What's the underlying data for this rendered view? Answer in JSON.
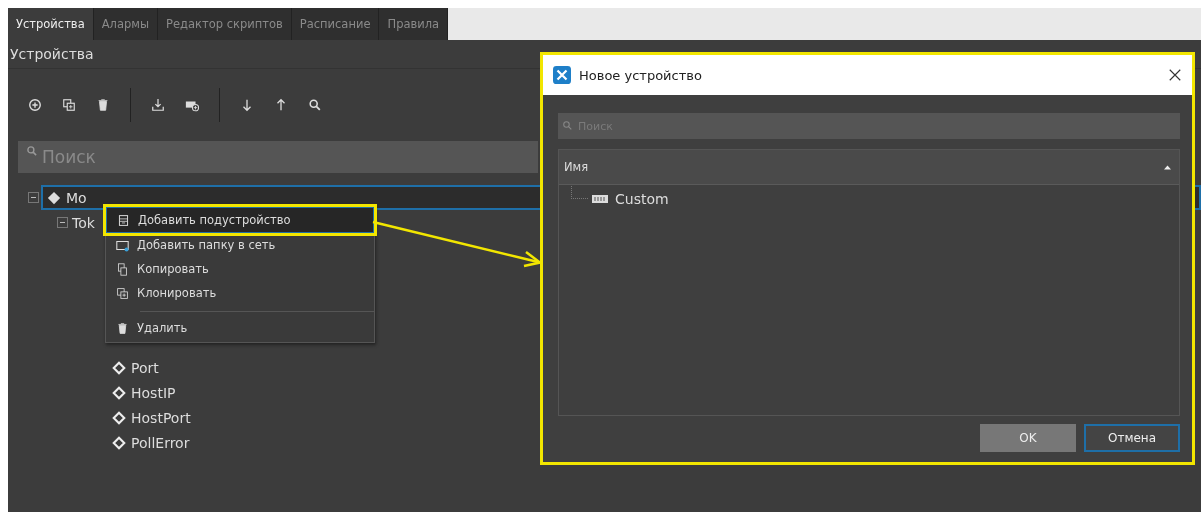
{
  "tabs": [
    {
      "label": "Устройства",
      "selected": true
    },
    {
      "label": "Алармы",
      "selected": false
    },
    {
      "label": "Редактор скриптов",
      "selected": false
    },
    {
      "label": "Расписание",
      "selected": false
    },
    {
      "label": "Правила",
      "selected": false
    }
  ],
  "panel": {
    "title": "Устройства",
    "search": {
      "placeholder": "Поиск"
    }
  },
  "tree": [
    {
      "label": "Mo",
      "kind": "device",
      "expanded": true,
      "selected": true,
      "children": [
        {
          "label": "Tok",
          "expanded": true,
          "selected": false,
          "children": [
            {
              "label": "Port",
              "kind": "tag",
              "selected": false
            },
            {
              "label": "HostIP",
              "kind": "tag",
              "selected": false
            },
            {
              "label": "HostPort",
              "kind": "tag",
              "selected": false
            },
            {
              "label": "PollError",
              "kind": "tag",
              "selected": false
            }
          ]
        }
      ]
    }
  ],
  "context_menu": [
    {
      "label": "Добавить подустройство",
      "kind": "subdevice",
      "selected": true
    },
    {
      "label": "Добавить папку в сеть",
      "kind": "folder",
      "selected": false
    },
    {
      "label": "Копировать",
      "kind": "copy",
      "selected": false
    },
    {
      "label": "Клонировать",
      "kind": "clone",
      "selected": false
    },
    {
      "label": "Удалить",
      "kind": "delete",
      "selected": false
    }
  ],
  "dialog": {
    "title": "Новое устройство",
    "search": {
      "placeholder": "Поиск"
    },
    "column": "Имя",
    "items": [
      {
        "label": "Custom",
        "selected": false
      }
    ],
    "buttons": [
      {
        "label": "OK",
        "kind": "primary"
      },
      {
        "label": "Отмена",
        "kind": "cancel"
      }
    ]
  }
}
